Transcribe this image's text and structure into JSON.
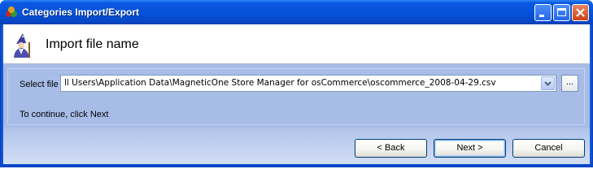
{
  "window": {
    "title": "Categories Import/Export",
    "app_icon": "app-icon",
    "controls": [
      "minimize-icon",
      "maximize-icon",
      "close-icon"
    ]
  },
  "header": {
    "title": "Import file name",
    "icon": "wizard-icon"
  },
  "form": {
    "file_label": "Select file",
    "file_value": "ll Users\\Application Data\\MagneticOne Store Manager for osCommerce\\oscommerce_2008-04-29.csv",
    "browse_label": "...",
    "continue_text": "To continue, click Next"
  },
  "buttons": {
    "back": "< Back",
    "next": "Next >",
    "cancel": "Cancel"
  },
  "colors": {
    "titlebar": "#0553d8",
    "panel": "#a7bde8",
    "footer": "#b0c3ea"
  }
}
